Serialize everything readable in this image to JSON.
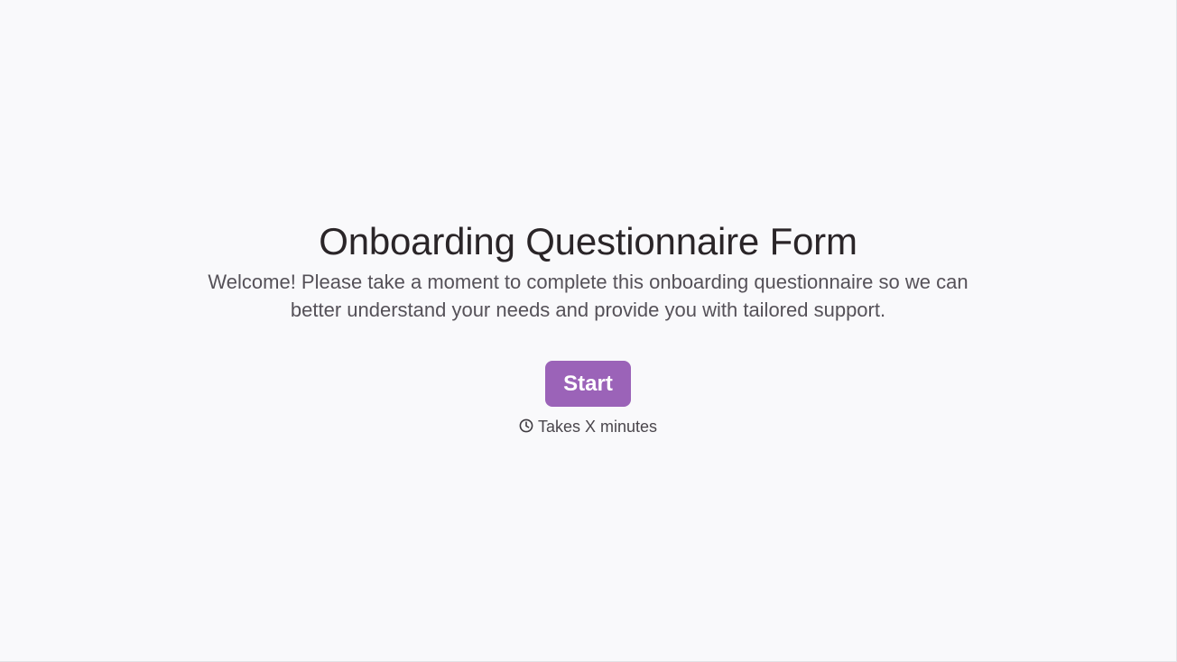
{
  "welcome": {
    "title": "Onboarding Questionnaire Form",
    "description": "Welcome! Please take a moment to complete this onboarding questionnaire so we can better understand your needs and provide you with tailored support.",
    "start_label": "Start",
    "duration_icon": "clock-icon",
    "duration_text": "Takes X minutes"
  },
  "colors": {
    "background": "#f9f9fb",
    "accent": "#9b63b8",
    "title_text": "#2a2528",
    "body_text": "#555158"
  }
}
